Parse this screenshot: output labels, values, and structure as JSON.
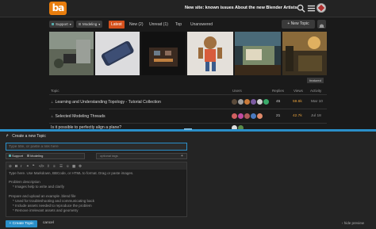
{
  "header": {
    "logo_text": "ba",
    "links": [
      "New site: known issues",
      "About the new Blender Artists"
    ]
  },
  "nav": {
    "category_chip": "Support",
    "sub_chip": "Modeling",
    "items": [
      "Latest",
      "New (2)",
      "Unread (1)",
      "Top",
      "Unanswered"
    ],
    "new_topic": "+ New Topic"
  },
  "featured_badge": "featured",
  "table": {
    "headers": {
      "topic": "Topic",
      "users": "Users",
      "replies": "Replies",
      "views": "Views",
      "activity": "Activity"
    },
    "rows": [
      {
        "title": "Learning and Understanding Topology - Tutorial Collection",
        "replies": "45",
        "views": "59.6k",
        "activity": "Mar 10"
      },
      {
        "title": "Selected Modeling Threads",
        "replies": "21",
        "views": "42.7k",
        "activity": "Jul 18"
      },
      {
        "title": "Is it possible to perfectly align a plane?",
        "replies": "",
        "views": "",
        "activity": ""
      }
    ]
  },
  "composer": {
    "header": "Create a new Topic",
    "title_placeholder": "Type title, or paste a link here",
    "category": "Support",
    "subcategory": "Modeling",
    "tags_placeholder": "optional tags",
    "body_lines": [
      "Type here. Use Markdown, BBCode, or HTML to format. Drag or paste images.",
      "",
      "Problem description",
      "    * Images help to write and clarify",
      "",
      "Prepare and upload an example .blend file",
      "    * Used for troubleshooting and communicating back",
      "    * Include assets needed to reproduce the problem",
      "    * Remove irrelevant assets and geometry"
    ],
    "create_label": "+ Create Topic",
    "cancel_label": "cancel",
    "hide_preview_label": "‹ hide preview"
  },
  "colors": {
    "accent_orange": "#d4501c",
    "composer_blue": "#2a8fc9",
    "views_hot": "#e8a13c"
  }
}
